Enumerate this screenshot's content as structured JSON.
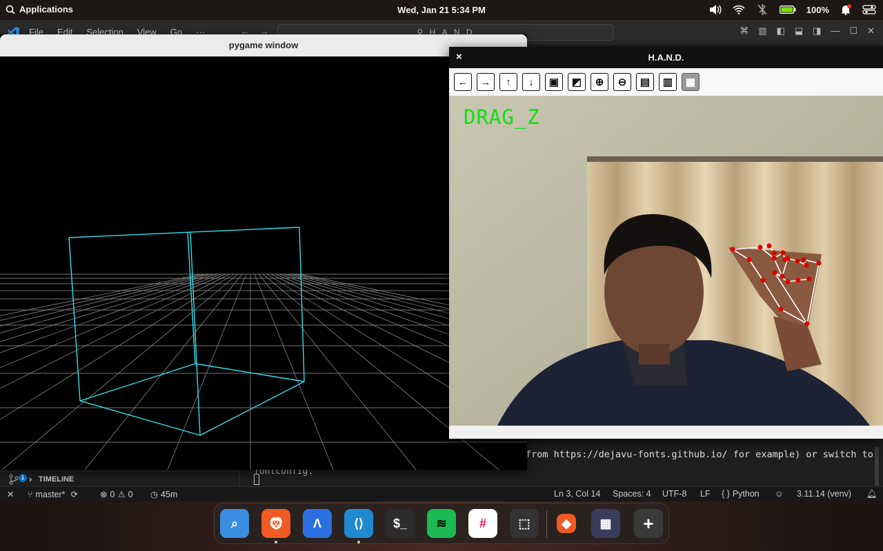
{
  "topbar": {
    "applications_label": "Applications",
    "datetime": "Wed, Jan 21   5:34 PM",
    "battery": "100%"
  },
  "vscode": {
    "menu": [
      "File",
      "Edit",
      "Selection",
      "View",
      "Go",
      "···"
    ],
    "search": "H.A.N.D",
    "terminal_line": "from https://dejavu-fonts.github.io/ for example) or switch to",
    "terminal_line2": "fontconfig.",
    "timeline_label": "TIMELINE",
    "scm_badge": "1",
    "status": {
      "branch": "master*",
      "errors": "0",
      "warnings": "0",
      "time": "45m",
      "position": "Ln 3, Col 14",
      "spaces": "Spaces: 4",
      "encoding": "UTF-8",
      "eol": "LF",
      "language": "Python",
      "interpreter": "3.11.14 (venv)"
    }
  },
  "pygame": {
    "title": "pygame window",
    "grid_color": "#9a9a9a",
    "cube_color": "#33e0f0"
  },
  "hand": {
    "title": "H.A.N.D.",
    "close_label": "×",
    "gesture_label": "DRAG_Z",
    "toolbar": [
      {
        "name": "back-icon",
        "glyph": "←"
      },
      {
        "name": "forward-icon",
        "glyph": "→"
      },
      {
        "name": "up-icon",
        "glyph": "↑"
      },
      {
        "name": "down-icon",
        "glyph": "↓"
      },
      {
        "name": "image-icon",
        "glyph": "▣"
      },
      {
        "name": "image-settings-icon",
        "glyph": "◩"
      },
      {
        "name": "zoom-in-icon",
        "glyph": "⊕"
      },
      {
        "name": "zoom-out-icon",
        "glyph": "⊖"
      },
      {
        "name": "save-icon",
        "glyph": "▤"
      },
      {
        "name": "clipboard-icon",
        "glyph": "▥"
      },
      {
        "name": "properties-icon",
        "glyph": "▦"
      }
    ],
    "landmark_color": "#e00000",
    "gesture_color": "#11e011"
  },
  "dock": {
    "apps": [
      {
        "name": "finder-app",
        "color": "#3a8de0"
      },
      {
        "name": "brave-app",
        "color": "#f05a24"
      },
      {
        "name": "arc-app",
        "color": "#2b6fe0"
      },
      {
        "name": "vscode-app",
        "color": "#1f8ad2"
      },
      {
        "name": "terminal-app",
        "color": "#2b2b2b"
      },
      {
        "name": "spotify-app",
        "color": "#1db954"
      },
      {
        "name": "slack-app",
        "color": "#ffffff"
      },
      {
        "name": "screenshot-app",
        "color": "#333333"
      },
      {
        "name": "brave-small-app",
        "color": "#f05a24"
      },
      {
        "name": "app-group",
        "color": "#3b3b5a"
      },
      {
        "name": "add-app",
        "color": "#3a3a3a"
      }
    ],
    "terminal_glyph": "$_",
    "add_glyph": "+"
  }
}
